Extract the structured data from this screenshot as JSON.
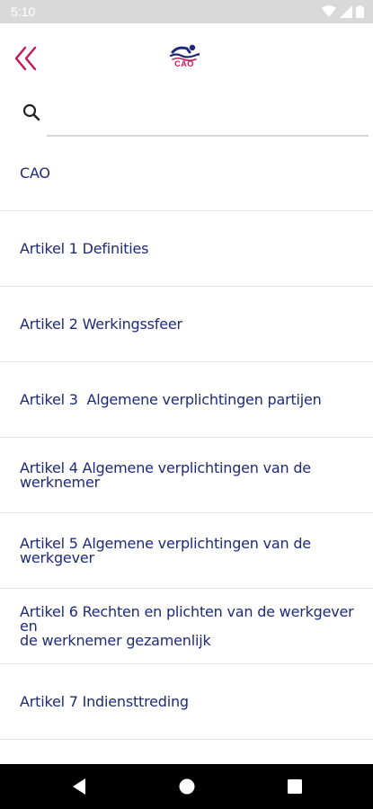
{
  "status_bar": {
    "time": "5:10"
  },
  "header": {
    "back_icon": "double-chevron-left-icon",
    "logo_text": "CAO",
    "accent_color": "#c2185b"
  },
  "search": {
    "placeholder": "",
    "value": ""
  },
  "list": {
    "text_color": "#1e2a78",
    "items": [
      {
        "label": "CAO"
      },
      {
        "label": "Artikel 1 Definities"
      },
      {
        "label": "Artikel 2 Werkingssfeer"
      },
      {
        "label": "Artikel 3  Algemene verplichtingen partijen"
      },
      {
        "label": "Artikel 4 Algemene verplichtingen van de\nwerknemer"
      },
      {
        "label": "Artikel 5 Algemene verplichtingen van de\nwerkgever"
      },
      {
        "label": "Artikel 6 Rechten en plichten van de werkgever en\nde werknemer gezamenlijk"
      },
      {
        "label": "Artikel 7 Indiensttreding"
      },
      {
        "label": ""
      }
    ]
  },
  "nav_bar": {
    "back": "nav-back-icon",
    "home": "nav-home-icon",
    "recents": "nav-recents-icon"
  }
}
